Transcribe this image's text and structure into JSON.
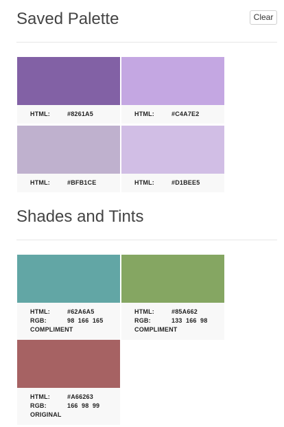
{
  "saved": {
    "title": "Saved Palette",
    "clear_label": "Clear",
    "items": [
      {
        "color": "#8261A5",
        "html_label": "HTML:",
        "hex": "#8261A5"
      },
      {
        "color": "#C4A7E2",
        "html_label": "HTML:",
        "hex": "#C4A7E2"
      },
      {
        "color": "#BFB1CE",
        "html_label": "HTML:",
        "hex": "#BFB1CE"
      },
      {
        "color": "#D1BEE5",
        "html_label": "HTML:",
        "hex": "#D1BEE5"
      }
    ]
  },
  "shades": {
    "title": "Shades and Tints",
    "items": [
      {
        "color": "#62A6A5",
        "html_label": "HTML:",
        "hex": "#62A6A5",
        "rgb_label": "RGB:",
        "rgb": "98  166  165",
        "tag": "COMPLIMENT"
      },
      {
        "color": "#85A662",
        "html_label": "HTML:",
        "hex": "#85A662",
        "rgb_label": "RGB:",
        "rgb": "133  166  98",
        "tag": "COMPLIMENT"
      },
      {
        "color": "#A66263",
        "html_label": "HTML:",
        "hex": "#A66263",
        "rgb_label": "RGB:",
        "rgb": "166  98  99",
        "tag": "ORIGINAL"
      }
    ]
  }
}
